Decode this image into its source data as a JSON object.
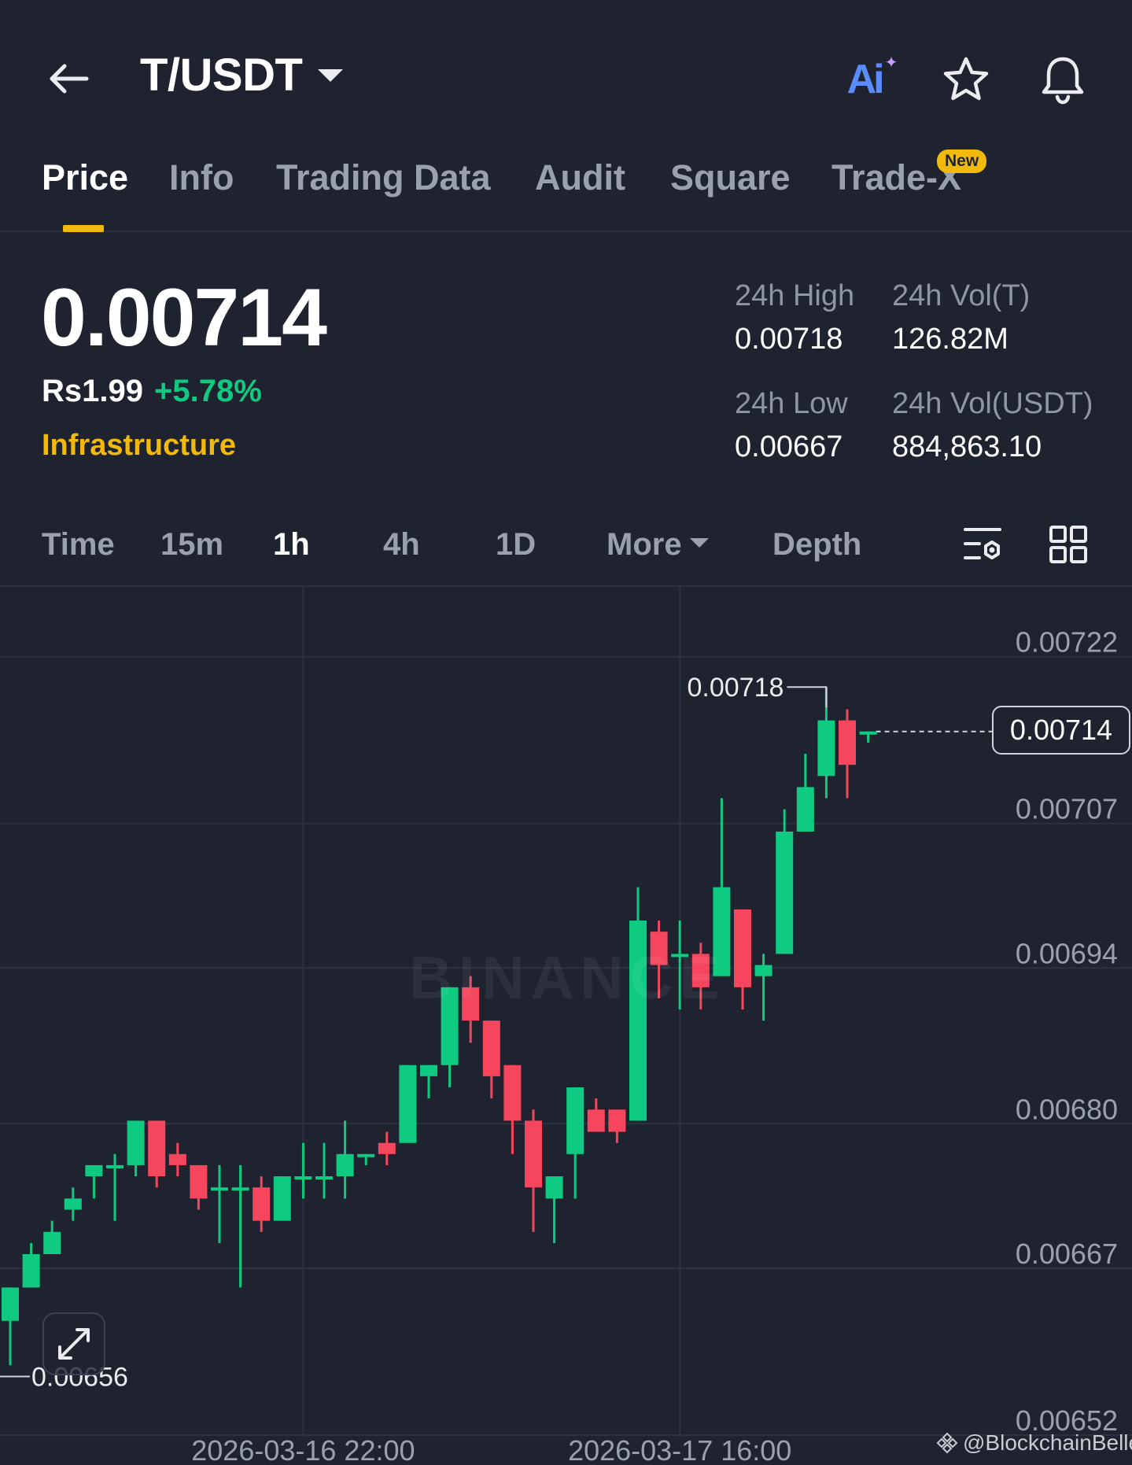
{
  "header": {
    "pair": "T/USDT",
    "ai_label": "Ai"
  },
  "tabs": [
    {
      "label": "Price",
      "active": true
    },
    {
      "label": "Info"
    },
    {
      "label": "Trading Data"
    },
    {
      "label": "Audit"
    },
    {
      "label": "Square"
    },
    {
      "label": "Trade-X",
      "badge": "New"
    }
  ],
  "price": {
    "last": "0.00714",
    "fiat": "Rs1.99",
    "change": "+5.78%",
    "category": "Infrastructure"
  },
  "stats": {
    "high_label": "24h High",
    "high_value": "0.00718",
    "low_label": "24h Low",
    "low_value": "0.00667",
    "vol_t_label": "24h Vol(T)",
    "vol_t_value": "126.82M",
    "vol_usdt_label": "24h Vol(USDT)",
    "vol_usdt_value": "884,863.10"
  },
  "intervals": {
    "time": "Time",
    "m15": "15m",
    "h1": "1h",
    "h4": "4h",
    "d1": "1D",
    "more": "More",
    "depth": "Depth"
  },
  "colors": {
    "up": "#0ecb81",
    "down": "#f6465d",
    "accent": "#f0b90b",
    "background": "#1f2330"
  },
  "icons": [
    "back-arrow-icon",
    "dropdown-caret-icon",
    "ai-icon",
    "star-icon",
    "bell-icon",
    "indicator-settings-icon",
    "grid-layout-icon",
    "expand-icon",
    "binance-logo-icon"
  ],
  "watermark": "BINANCE",
  "credit": "@BlockchainBelle",
  "chart_data": {
    "type": "candlestick",
    "interval": "1h",
    "y_ticks": [
      0.00722,
      0.00707,
      0.00694,
      0.0068,
      0.00667,
      0.00652
    ],
    "y_tick_labels": [
      "0.00722",
      "0.00707",
      "0.00694",
      "0.00680",
      "0.00667",
      "0.00652"
    ],
    "ylim": [
      0.00652,
      0.00727
    ],
    "x_tick_labels": [
      "2026-03-16 22:00",
      "2026-03-17 16:00"
    ],
    "x_tick_index": [
      14,
      32
    ],
    "current_price": 0.00714,
    "current_price_label": "0.00714",
    "high_marker": {
      "label": "0.00718",
      "index": 39,
      "value": 0.00718
    },
    "low_marker": {
      "label": "0.00656",
      "index": 0,
      "value": 0.00656
    },
    "candles": [
      {
        "o": 0.00661,
        "h": 0.00663,
        "l": 0.00657,
        "c": 0.00664
      },
      {
        "o": 0.00664,
        "h": 0.00668,
        "l": 0.00664,
        "c": 0.00667
      },
      {
        "o": 0.00667,
        "h": 0.0067,
        "l": 0.00667,
        "c": 0.00669
      },
      {
        "o": 0.00671,
        "h": 0.00673,
        "l": 0.0067,
        "c": 0.00672
      },
      {
        "o": 0.00674,
        "h": 0.00675,
        "l": 0.00672,
        "c": 0.00675
      },
      {
        "o": 0.00675,
        "h": 0.00676,
        "l": 0.0067,
        "c": 0.00675
      },
      {
        "o": 0.00675,
        "h": 0.00678,
        "l": 0.00674,
        "c": 0.00679
      },
      {
        "o": 0.00679,
        "h": 0.00679,
        "l": 0.00673,
        "c": 0.00674
      },
      {
        "o": 0.00676,
        "h": 0.00677,
        "l": 0.00674,
        "c": 0.00675
      },
      {
        "o": 0.00675,
        "h": 0.00675,
        "l": 0.00671,
        "c": 0.00672
      },
      {
        "o": 0.00673,
        "h": 0.00675,
        "l": 0.00668,
        "c": 0.00673
      },
      {
        "o": 0.00673,
        "h": 0.00675,
        "l": 0.00664,
        "c": 0.00673
      },
      {
        "o": 0.00673,
        "h": 0.00674,
        "l": 0.00669,
        "c": 0.0067
      },
      {
        "o": 0.0067,
        "h": 0.00674,
        "l": 0.0067,
        "c": 0.00674
      },
      {
        "o": 0.00674,
        "h": 0.00677,
        "l": 0.00672,
        "c": 0.00674
      },
      {
        "o": 0.00674,
        "h": 0.00677,
        "l": 0.00672,
        "c": 0.00674
      },
      {
        "o": 0.00674,
        "h": 0.00679,
        "l": 0.00672,
        "c": 0.00676
      },
      {
        "o": 0.00676,
        "h": 0.00676,
        "l": 0.00675,
        "c": 0.00676
      },
      {
        "o": 0.00677,
        "h": 0.00678,
        "l": 0.00675,
        "c": 0.00676
      },
      {
        "o": 0.00677,
        "h": 0.00682,
        "l": 0.00677,
        "c": 0.00684
      },
      {
        "o": 0.00683,
        "h": 0.00684,
        "l": 0.00681,
        "c": 0.00684
      },
      {
        "o": 0.00684,
        "h": 0.0069,
        "l": 0.00682,
        "c": 0.00691
      },
      {
        "o": 0.00691,
        "h": 0.00692,
        "l": 0.00686,
        "c": 0.00688
      },
      {
        "o": 0.00688,
        "h": 0.00688,
        "l": 0.00681,
        "c": 0.00683
      },
      {
        "o": 0.00684,
        "h": 0.00684,
        "l": 0.00676,
        "c": 0.00679
      },
      {
        "o": 0.00679,
        "h": 0.0068,
        "l": 0.00669,
        "c": 0.00673
      },
      {
        "o": 0.00672,
        "h": 0.00674,
        "l": 0.00668,
        "c": 0.00674
      },
      {
        "o": 0.00676,
        "h": 0.0068,
        "l": 0.00672,
        "c": 0.00682
      },
      {
        "o": 0.0068,
        "h": 0.00681,
        "l": 0.00678,
        "c": 0.00678
      },
      {
        "o": 0.0068,
        "h": 0.0068,
        "l": 0.00677,
        "c": 0.00678
      },
      {
        "o": 0.00679,
        "h": 0.007,
        "l": 0.00679,
        "c": 0.00697
      },
      {
        "o": 0.00696,
        "h": 0.00697,
        "l": 0.0069,
        "c": 0.00693
      },
      {
        "o": 0.00694,
        "h": 0.00697,
        "l": 0.00689,
        "c": 0.00694
      },
      {
        "o": 0.00694,
        "h": 0.00695,
        "l": 0.00689,
        "c": 0.00691
      },
      {
        "o": 0.00692,
        "h": 0.00708,
        "l": 0.00692,
        "c": 0.007
      },
      {
        "o": 0.00698,
        "h": 0.00698,
        "l": 0.00689,
        "c": 0.00691
      },
      {
        "o": 0.00692,
        "h": 0.00694,
        "l": 0.00688,
        "c": 0.00693
      },
      {
        "o": 0.00694,
        "h": 0.00707,
        "l": 0.00694,
        "c": 0.00705
      },
      {
        "o": 0.00705,
        "h": 0.00712,
        "l": 0.00705,
        "c": 0.00709
      },
      {
        "o": 0.0071,
        "h": 0.00718,
        "l": 0.00708,
        "c": 0.00715
      },
      {
        "o": 0.00715,
        "h": 0.00716,
        "l": 0.00708,
        "c": 0.00711
      },
      {
        "o": 0.00714,
        "h": 0.00714,
        "l": 0.00713,
        "c": 0.00714
      }
    ]
  }
}
